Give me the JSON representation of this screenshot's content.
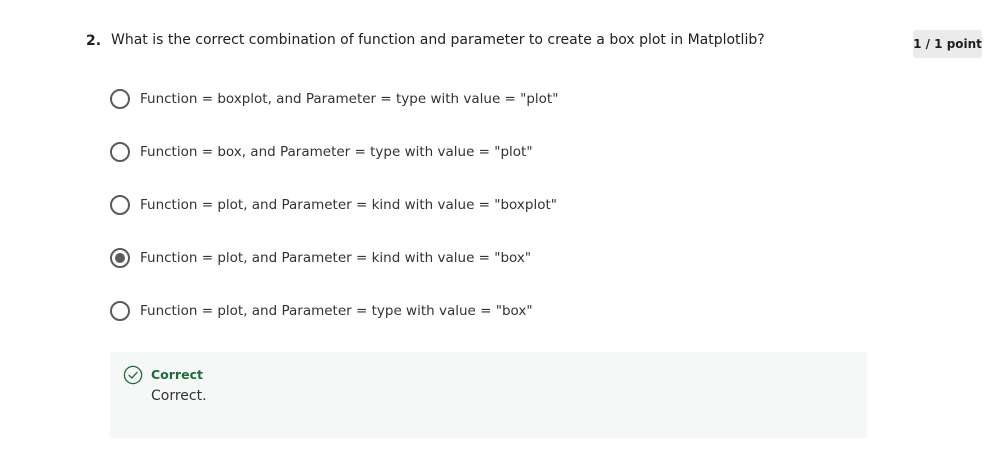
{
  "question": {
    "number": "2.",
    "text": "What is the correct combination of function and parameter to create a box plot in Matplotlib?",
    "score": "1 / 1 point"
  },
  "options": [
    {
      "label": "Function = boxplot, and Parameter = type with value = \"plot\"",
      "selected": false
    },
    {
      "label": "Function = box, and Parameter = type with value = \"plot\"",
      "selected": false
    },
    {
      "label": "Function = plot, and Parameter = kind with value = \"boxplot\"",
      "selected": false
    },
    {
      "label": "Function = plot, and Parameter = kind with value = \"box\"",
      "selected": true
    },
    {
      "label": "Function = plot, and Parameter = type with value = \"box\"",
      "selected": false
    }
  ],
  "feedback": {
    "title": "Correct",
    "body": "Correct.",
    "icon": "check-circle-icon",
    "color": "#1e6b3a"
  }
}
